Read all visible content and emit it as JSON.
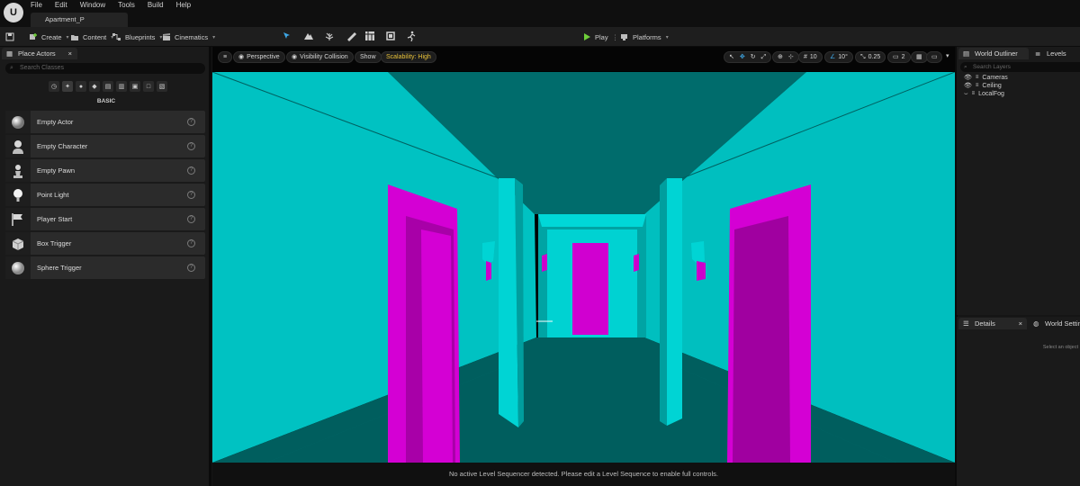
{
  "app": {
    "menu": [
      "File",
      "Edit",
      "Window",
      "Tools",
      "Build",
      "Help"
    ],
    "document_tab": "Apartment_P"
  },
  "toolbar": {
    "create_label": "Create",
    "content_label": "Content",
    "blueprints_label": "Blueprints",
    "cinematics_label": "Cinematics",
    "play_label": "Play",
    "platforms_label": "Platforms",
    "play_color": "#6fcf3a"
  },
  "place_actors": {
    "tab_label": "Place Actors",
    "search_placeholder": "Search Classes",
    "category_label": "BASIC",
    "items": [
      {
        "label": "Empty Actor",
        "icon": "sphere-icon"
      },
      {
        "label": "Empty Character",
        "icon": "character-icon"
      },
      {
        "label": "Empty Pawn",
        "icon": "pawn-icon"
      },
      {
        "label": "Point Light",
        "icon": "light-bulb-icon"
      },
      {
        "label": "Player Start",
        "icon": "flag-icon"
      },
      {
        "label": "Box Trigger",
        "icon": "box-icon"
      },
      {
        "label": "Sphere Trigger",
        "icon": "sphere-trigger-icon"
      }
    ]
  },
  "viewport": {
    "perspective_label": "Perspective",
    "view_mode_label": "Visibility Collision",
    "show_label": "Show",
    "scalability_label": "Scalability: High",
    "scalability_color": "#e8c23a",
    "grid_snap": "10",
    "rotation_snap": "10°",
    "scale_snap": "0.25",
    "camera_speed": "2",
    "status_message": "No active Level Sequencer detected. Please edit a Level Sequence to enable full controls.",
    "colors": {
      "cyan": "#00c8c8",
      "magenta": "#cc00cc"
    }
  },
  "outliner": {
    "tab_label": "World Outliner",
    "levels_tab_label": "Levels",
    "search_placeholder": "Search Layers",
    "layers": [
      "Cameras",
      "Ceiling",
      "LocalFog"
    ]
  },
  "details": {
    "tab_label": "Details",
    "world_settings_label": "World Settings",
    "hint": "Select an object"
  }
}
